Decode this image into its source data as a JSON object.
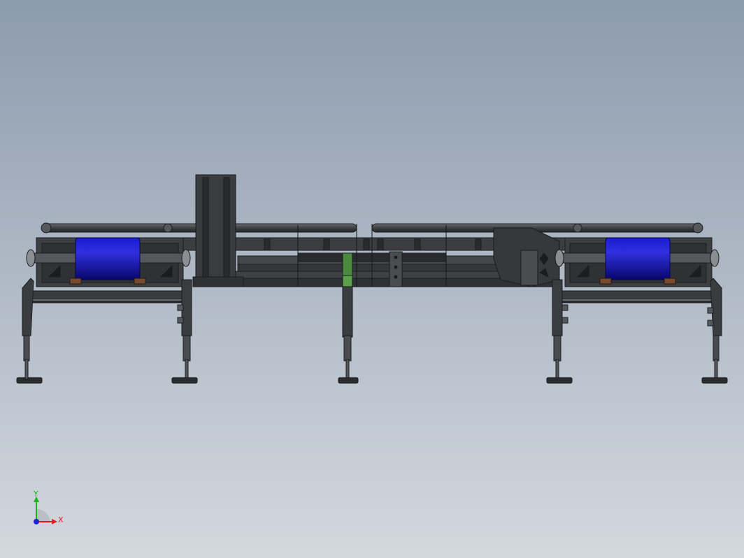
{
  "view": {
    "background_top": "#8c9bae",
    "background_bottom": "#d3d8de"
  },
  "model": {
    "frame_color": "#3d3f43",
    "frame_dark": "#2a2b2e",
    "roller_color": "#0a0aa0",
    "roller_highlight": "#3b3bdc",
    "bracket_color": "#4a8a3c",
    "pad_color": "#7a4a2a"
  },
  "triad": {
    "x_label": "X",
    "y_label": "Y",
    "x_color": "#e02020",
    "y_color": "#20b020",
    "z_color": "#2020d0"
  }
}
